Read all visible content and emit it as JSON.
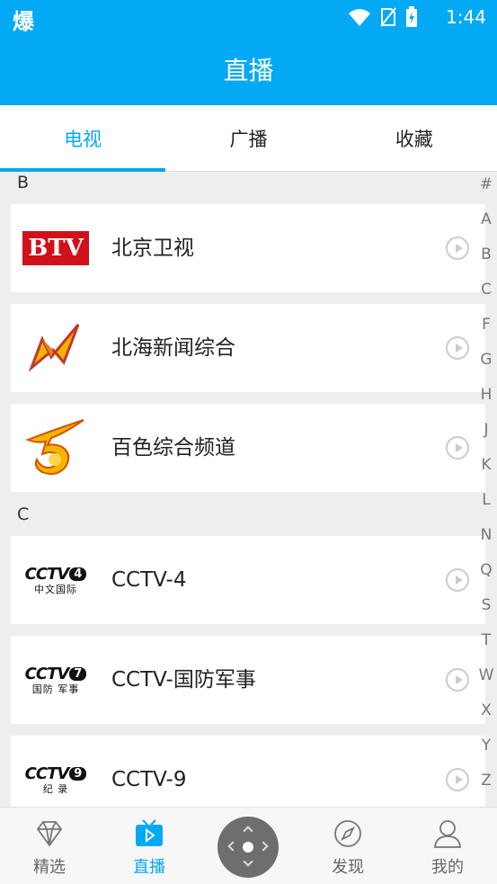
{
  "status_bar": {
    "app_glyph": "爆",
    "time": "1:44"
  },
  "header": {
    "title": "直播"
  },
  "tabs": [
    {
      "label": "电视",
      "active": true
    },
    {
      "label": "广播",
      "active": false
    },
    {
      "label": "收藏",
      "active": false
    }
  ],
  "sections": [
    {
      "letter": "B",
      "channels": [
        {
          "name": "北京卫视",
          "logo": "BTV"
        },
        {
          "name": "北海新闻综合",
          "logo": "beihai-logo"
        },
        {
          "name": "百色综合频道",
          "logo": "baise-logo"
        }
      ]
    },
    {
      "letter": "C",
      "channels": [
        {
          "name": "CCTV-4",
          "logo_letters": "CCTV",
          "logo_num": "4",
          "logo_sub": "中文国际"
        },
        {
          "name": "CCTV-国防军事",
          "logo_letters": "CCTV",
          "logo_num": "7",
          "logo_sub": "国防 军事"
        },
        {
          "name": "CCTV-9",
          "logo_letters": "CCTV",
          "logo_num": "9",
          "logo_sub": "纪 录"
        }
      ]
    }
  ],
  "index_letters": [
    "#",
    "A",
    "B",
    "C",
    "F",
    "G",
    "H",
    "J",
    "K",
    "L",
    "N",
    "Q",
    "S",
    "T",
    "W",
    "X",
    "Y",
    "Z"
  ],
  "bottom_nav": [
    {
      "label": "精选",
      "icon": "diamond-icon"
    },
    {
      "label": "直播",
      "icon": "tv-icon",
      "active": true
    },
    {
      "label": "发现",
      "icon": "compass-icon"
    },
    {
      "label": "我的",
      "icon": "person-icon"
    }
  ],
  "colors": {
    "accent": "#03a9f4",
    "btv_red": "#d0111a"
  }
}
